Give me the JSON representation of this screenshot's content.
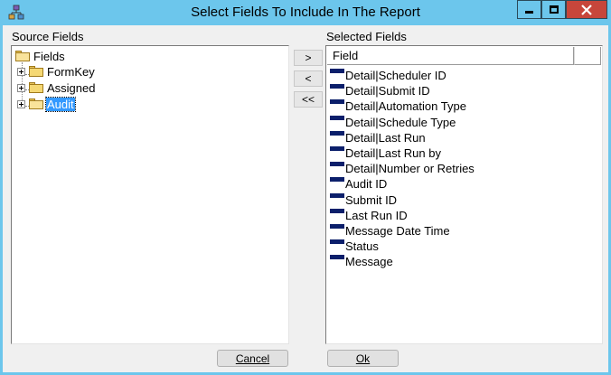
{
  "window": {
    "title": "Select Fields To Include In The Report",
    "app_icon": "network-nodes-icon",
    "controls": {
      "minimize": "minimize-icon",
      "maximize": "maximize-icon",
      "close": "close-icon"
    }
  },
  "source": {
    "label": "Source Fields",
    "tree": {
      "root": "Fields",
      "children": [
        {
          "label": "FormKey",
          "expandable": true,
          "selected": false
        },
        {
          "label": "Assigned",
          "expandable": true,
          "selected": false
        },
        {
          "label": "Audit",
          "expandable": true,
          "selected": true
        }
      ]
    }
  },
  "transfer_buttons": {
    "add": ">",
    "remove": "<",
    "remove_all": "<<"
  },
  "selected": {
    "label": "Selected Fields",
    "column_header": "Field",
    "items": [
      "Detail|Scheduler ID",
      "Detail|Submit ID",
      "Detail|Automation Type",
      "Detail|Schedule Type",
      "Detail|Last Run",
      "Detail|Last Run by",
      "Detail|Number or Retries",
      "Audit ID",
      "Submit ID",
      "Last Run ID",
      "Message Date Time",
      "Status",
      "Message"
    ]
  },
  "buttons": {
    "cancel": "Cancel",
    "ok": "Ok"
  },
  "colors": {
    "titlebar": "#6cc6ec",
    "close_button": "#c7463b",
    "selection": "#3399ff",
    "field_icon": "#0b1f6b"
  }
}
